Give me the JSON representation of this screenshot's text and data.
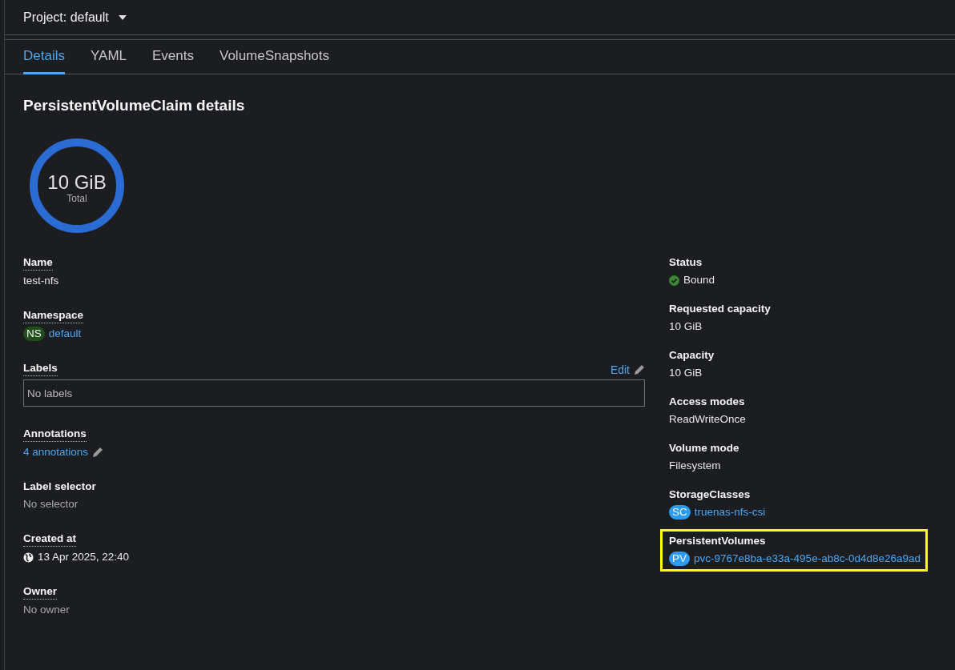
{
  "project": {
    "label": "Project: default"
  },
  "tabs": [
    {
      "label": "Details",
      "selected": true
    },
    {
      "label": "YAML",
      "selected": false
    },
    {
      "label": "Events",
      "selected": false
    },
    {
      "label": "VolumeSnapshots",
      "selected": false
    }
  ],
  "title": "PersistentVolumeClaim details",
  "donut": {
    "value": "10 GiB",
    "caption": "Total"
  },
  "left_fields": [
    {
      "kind": "text",
      "label": "Name",
      "has_help": true,
      "value": "test-nfs"
    },
    {
      "kind": "badge",
      "label": "Namespace",
      "has_help": true,
      "badge": "NS",
      "color": "#1e4f18",
      "value": "default"
    },
    {
      "kind": "labels",
      "label": "Labels",
      "has_help": true,
      "edit": "Edit",
      "value": "No labels"
    },
    {
      "kind": "link-edit",
      "label": "Annotations",
      "has_help": true,
      "value": "4 annotations"
    },
    {
      "kind": "muted",
      "label": "Label selector",
      "has_help": false,
      "value": "No selector"
    },
    {
      "kind": "date",
      "label": "Created at",
      "has_help": true,
      "value": "13 Apr 2025, 22:40"
    },
    {
      "kind": "muted",
      "label": "Owner",
      "has_help": true,
      "value": "No owner"
    }
  ],
  "right_fields": [
    {
      "kind": "status",
      "label": "Status",
      "value": "Bound",
      "highlighted": false
    },
    {
      "kind": "text",
      "label": "Requested capacity",
      "value": "10 GiB",
      "highlighted": false
    },
    {
      "kind": "text",
      "label": "Capacity",
      "value": "10 GiB",
      "highlighted": false
    },
    {
      "kind": "text",
      "label": "Access modes",
      "value": "ReadWriteOnce",
      "highlighted": false
    },
    {
      "kind": "text",
      "label": "Volume mode",
      "value": "Filesystem",
      "highlighted": false
    },
    {
      "kind": "badge",
      "label": "StorageClasses",
      "badge": "SC",
      "color": "#2b9af3",
      "value": "truenas-nfs-csi",
      "highlighted": false
    },
    {
      "kind": "badge",
      "label": "PersistentVolumes",
      "badge": "PV",
      "color": "#2b9af3",
      "value": "pvc-9767e8ba-e33a-495e-ab8c-0d4d8e26a9ad",
      "highlighted": true
    }
  ]
}
